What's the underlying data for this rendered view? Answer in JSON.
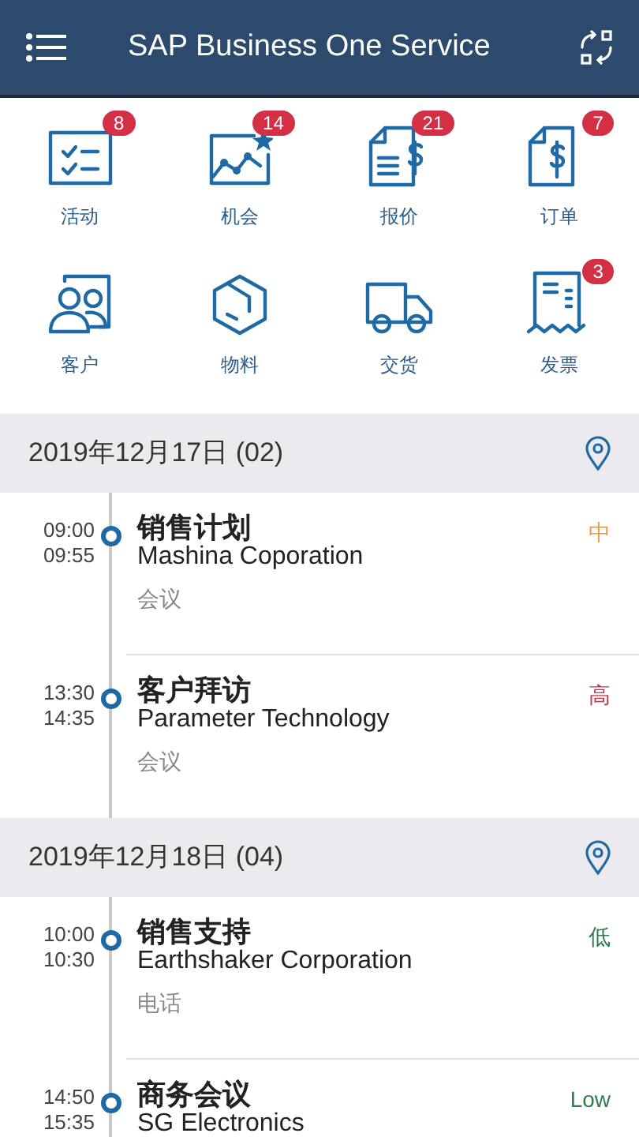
{
  "header": {
    "title": "SAP Business One Service"
  },
  "tiles": [
    {
      "kind": "activities",
      "label": "活动",
      "badge": "8"
    },
    {
      "kind": "opportunities",
      "label": "机会",
      "badge": "14"
    },
    {
      "kind": "quotations",
      "label": "报价",
      "badge": "21"
    },
    {
      "kind": "orders",
      "label": "订单",
      "badge": "7"
    },
    {
      "kind": "customers",
      "label": "客户"
    },
    {
      "kind": "items",
      "label": "物料"
    },
    {
      "kind": "deliveries",
      "label": "交货"
    },
    {
      "kind": "invoices",
      "label": "发票",
      "badge": "3"
    }
  ],
  "days": [
    {
      "date": "2019年12月17日 (02)",
      "events": [
        {
          "start": "09:00",
          "end": "09:55",
          "title": "销售计划",
          "company": "Mashina Coporation",
          "type": "会议",
          "priority": {
            "text": "中",
            "color": "#e5a23a"
          }
        },
        {
          "start": "13:30",
          "end": "14:35",
          "title": "客户拜访",
          "company": "Parameter Technology",
          "type": "会议",
          "priority": {
            "text": "高",
            "color": "#c4384c"
          }
        }
      ]
    },
    {
      "date": "2019年12月18日 (04)",
      "events": [
        {
          "start": "10:00",
          "end": "10:30",
          "title": "销售支持",
          "company": "Earthshaker Corporation",
          "type": "电话",
          "priority": {
            "text": "低",
            "color": "#2e7d4f"
          }
        },
        {
          "start": "14:50",
          "end": "15:35",
          "title": "商务会议",
          "company": "SG Electronics",
          "priority": {
            "text": "Low",
            "color": "#2e7d4f"
          }
        }
      ]
    }
  ]
}
